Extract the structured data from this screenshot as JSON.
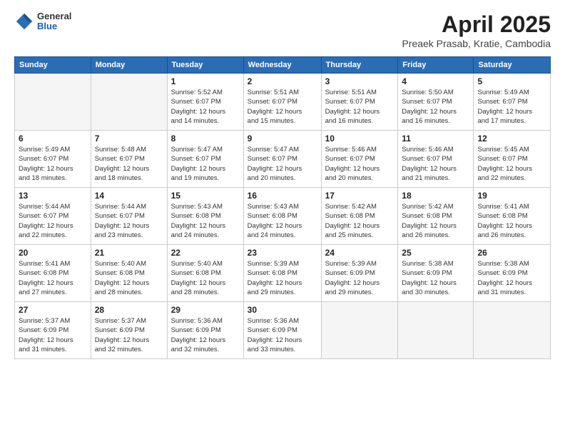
{
  "header": {
    "logo_general": "General",
    "logo_blue": "Blue",
    "main_title": "April 2025",
    "subtitle": "Preaek Prasab, Kratie, Cambodia"
  },
  "weekdays": [
    "Sunday",
    "Monday",
    "Tuesday",
    "Wednesday",
    "Thursday",
    "Friday",
    "Saturday"
  ],
  "weeks": [
    [
      {
        "day": "",
        "info": ""
      },
      {
        "day": "",
        "info": ""
      },
      {
        "day": "1",
        "info": "Sunrise: 5:52 AM\nSunset: 6:07 PM\nDaylight: 12 hours\nand 14 minutes."
      },
      {
        "day": "2",
        "info": "Sunrise: 5:51 AM\nSunset: 6:07 PM\nDaylight: 12 hours\nand 15 minutes."
      },
      {
        "day": "3",
        "info": "Sunrise: 5:51 AM\nSunset: 6:07 PM\nDaylight: 12 hours\nand 16 minutes."
      },
      {
        "day": "4",
        "info": "Sunrise: 5:50 AM\nSunset: 6:07 PM\nDaylight: 12 hours\nand 16 minutes."
      },
      {
        "day": "5",
        "info": "Sunrise: 5:49 AM\nSunset: 6:07 PM\nDaylight: 12 hours\nand 17 minutes."
      }
    ],
    [
      {
        "day": "6",
        "info": "Sunrise: 5:49 AM\nSunset: 6:07 PM\nDaylight: 12 hours\nand 18 minutes."
      },
      {
        "day": "7",
        "info": "Sunrise: 5:48 AM\nSunset: 6:07 PM\nDaylight: 12 hours\nand 18 minutes."
      },
      {
        "day": "8",
        "info": "Sunrise: 5:47 AM\nSunset: 6:07 PM\nDaylight: 12 hours\nand 19 minutes."
      },
      {
        "day": "9",
        "info": "Sunrise: 5:47 AM\nSunset: 6:07 PM\nDaylight: 12 hours\nand 20 minutes."
      },
      {
        "day": "10",
        "info": "Sunrise: 5:46 AM\nSunset: 6:07 PM\nDaylight: 12 hours\nand 20 minutes."
      },
      {
        "day": "11",
        "info": "Sunrise: 5:46 AM\nSunset: 6:07 PM\nDaylight: 12 hours\nand 21 minutes."
      },
      {
        "day": "12",
        "info": "Sunrise: 5:45 AM\nSunset: 6:07 PM\nDaylight: 12 hours\nand 22 minutes."
      }
    ],
    [
      {
        "day": "13",
        "info": "Sunrise: 5:44 AM\nSunset: 6:07 PM\nDaylight: 12 hours\nand 22 minutes."
      },
      {
        "day": "14",
        "info": "Sunrise: 5:44 AM\nSunset: 6:07 PM\nDaylight: 12 hours\nand 23 minutes."
      },
      {
        "day": "15",
        "info": "Sunrise: 5:43 AM\nSunset: 6:08 PM\nDaylight: 12 hours\nand 24 minutes."
      },
      {
        "day": "16",
        "info": "Sunrise: 5:43 AM\nSunset: 6:08 PM\nDaylight: 12 hours\nand 24 minutes."
      },
      {
        "day": "17",
        "info": "Sunrise: 5:42 AM\nSunset: 6:08 PM\nDaylight: 12 hours\nand 25 minutes."
      },
      {
        "day": "18",
        "info": "Sunrise: 5:42 AM\nSunset: 6:08 PM\nDaylight: 12 hours\nand 26 minutes."
      },
      {
        "day": "19",
        "info": "Sunrise: 5:41 AM\nSunset: 6:08 PM\nDaylight: 12 hours\nand 26 minutes."
      }
    ],
    [
      {
        "day": "20",
        "info": "Sunrise: 5:41 AM\nSunset: 6:08 PM\nDaylight: 12 hours\nand 27 minutes."
      },
      {
        "day": "21",
        "info": "Sunrise: 5:40 AM\nSunset: 6:08 PM\nDaylight: 12 hours\nand 28 minutes."
      },
      {
        "day": "22",
        "info": "Sunrise: 5:40 AM\nSunset: 6:08 PM\nDaylight: 12 hours\nand 28 minutes."
      },
      {
        "day": "23",
        "info": "Sunrise: 5:39 AM\nSunset: 6:08 PM\nDaylight: 12 hours\nand 29 minutes."
      },
      {
        "day": "24",
        "info": "Sunrise: 5:39 AM\nSunset: 6:09 PM\nDaylight: 12 hours\nand 29 minutes."
      },
      {
        "day": "25",
        "info": "Sunrise: 5:38 AM\nSunset: 6:09 PM\nDaylight: 12 hours\nand 30 minutes."
      },
      {
        "day": "26",
        "info": "Sunrise: 5:38 AM\nSunset: 6:09 PM\nDaylight: 12 hours\nand 31 minutes."
      }
    ],
    [
      {
        "day": "27",
        "info": "Sunrise: 5:37 AM\nSunset: 6:09 PM\nDaylight: 12 hours\nand 31 minutes."
      },
      {
        "day": "28",
        "info": "Sunrise: 5:37 AM\nSunset: 6:09 PM\nDaylight: 12 hours\nand 32 minutes."
      },
      {
        "day": "29",
        "info": "Sunrise: 5:36 AM\nSunset: 6:09 PM\nDaylight: 12 hours\nand 32 minutes."
      },
      {
        "day": "30",
        "info": "Sunrise: 5:36 AM\nSunset: 6:09 PM\nDaylight: 12 hours\nand 33 minutes."
      },
      {
        "day": "",
        "info": ""
      },
      {
        "day": "",
        "info": ""
      },
      {
        "day": "",
        "info": ""
      }
    ]
  ]
}
